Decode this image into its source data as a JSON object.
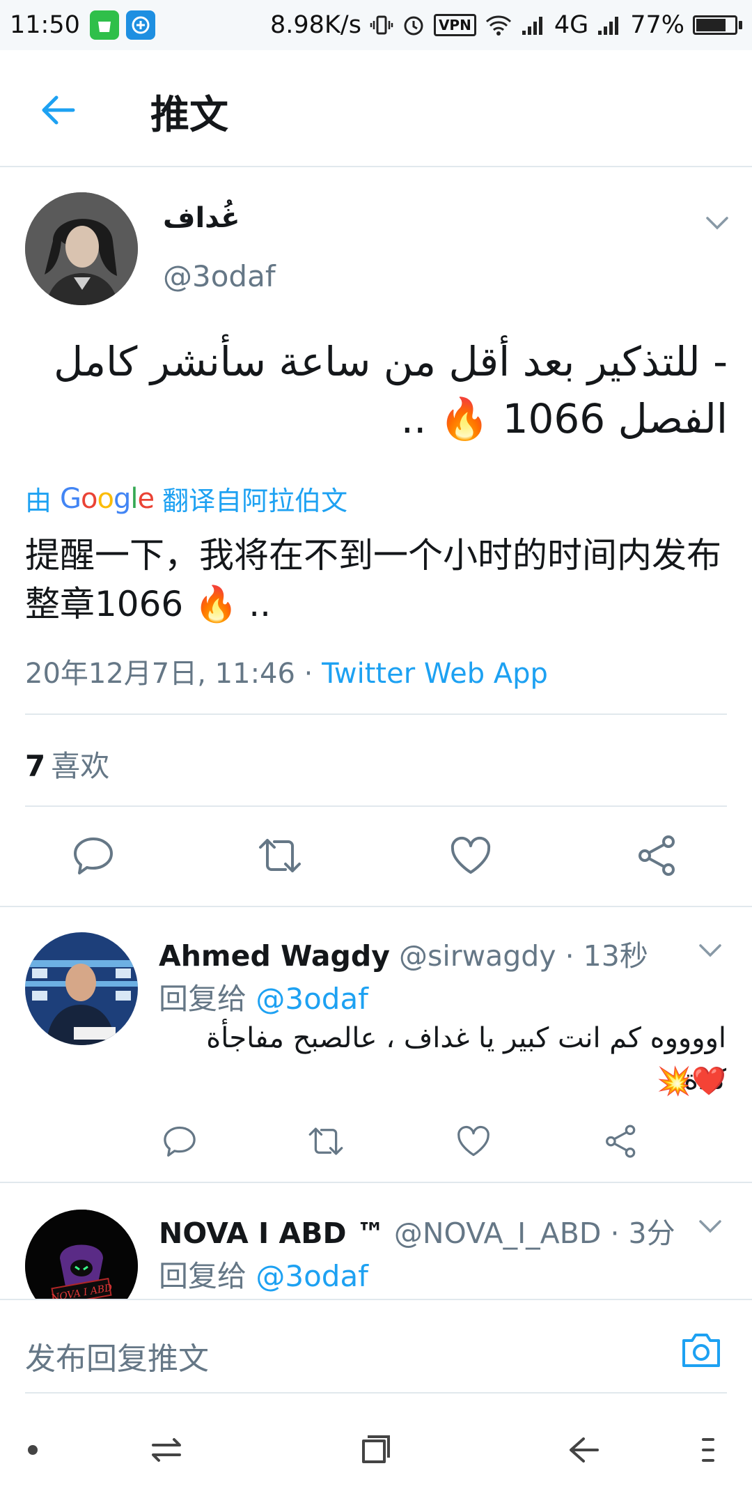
{
  "status_bar": {
    "time": "11:50",
    "network_speed": "8.98K/s",
    "vpn": "VPN",
    "network_type": "4G",
    "battery": "77%",
    "battery_level": 0.77
  },
  "header": {
    "title": "推文"
  },
  "tweet": {
    "author_name": "غُداف",
    "author_handle": "@3odaf",
    "text_original": "- للتذكير بعد أقل من ساعة سأنشر كامل الفصل 1066 🔥 ..",
    "translated_by": {
      "prefix": "由",
      "brand": "Google",
      "suffix": "翻译自阿拉伯文"
    },
    "text_translation": "提醒一下，我将在不到一个小时的时间内发布整章1066 🔥 ..",
    "timestamp": "20年12月7日, 11:46 · ",
    "via": "Twitter Web App",
    "likes_count": "7",
    "likes_label": "喜欢"
  },
  "replies": [
    {
      "name": "Ahmed Wagdy",
      "handle": "@sirwagdy",
      "time": " · 13秒",
      "reply_to_prefix": "回复给 ",
      "reply_to_handle": "@3odaf",
      "text": "اووووه كم انت كبير يا غداف ، عالصبح مفاجأة كدة",
      "emojis": "❤️💥"
    },
    {
      "name": "NOVA I ABD ™",
      "handle": "@NOVA_I_ABD",
      "time": " · 3分",
      "reply_to_prefix": "回复给 ",
      "reply_to_handle": "@3odaf",
      "avatar_text": "NOVA I ABD"
    }
  ],
  "compose": {
    "placeholder": "发布回复推文"
  },
  "colors": {
    "accent": "#1da1f2",
    "muted": "#657786",
    "divider": "#e1e8ed",
    "heart_red": "#e0245e"
  }
}
